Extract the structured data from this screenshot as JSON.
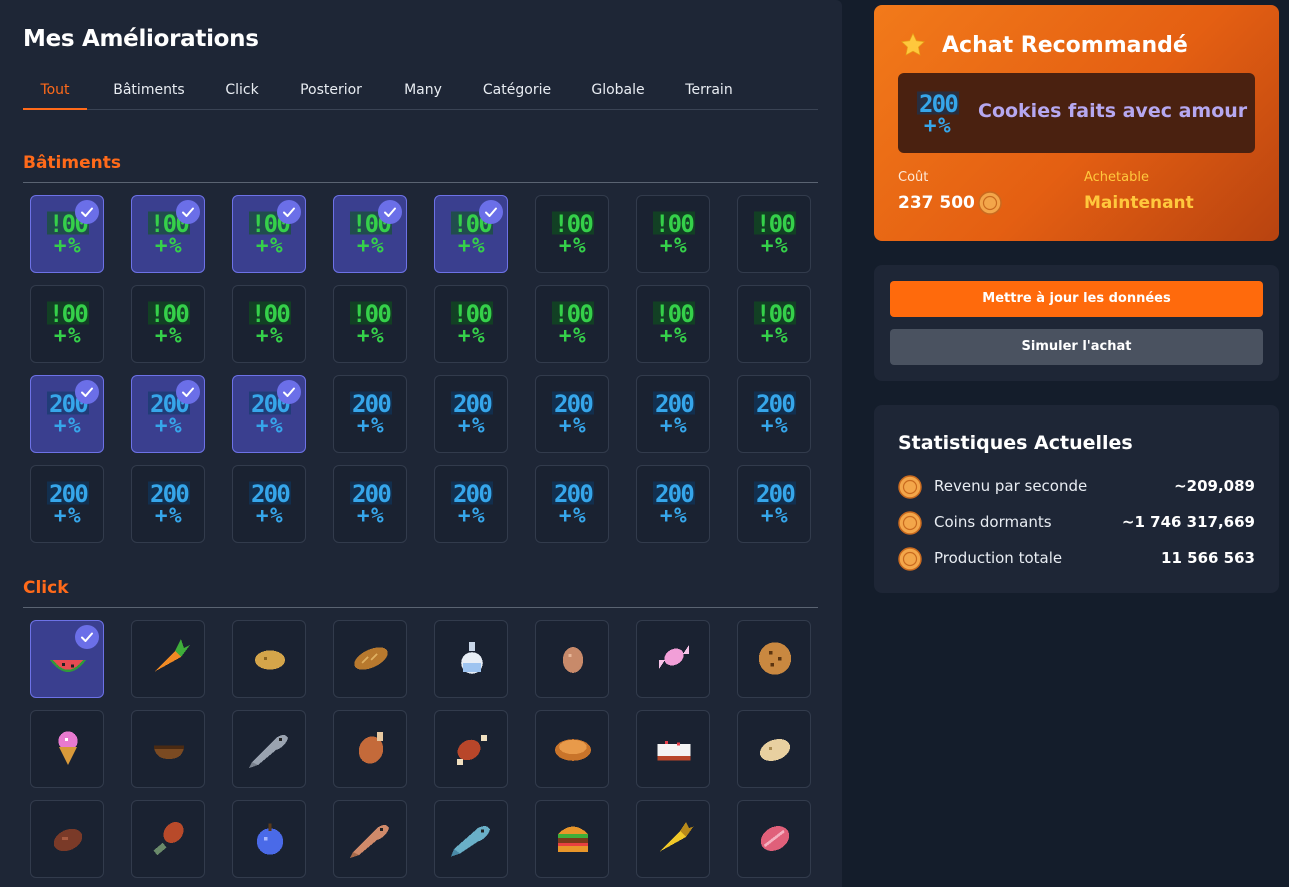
{
  "page_title": "Mes Améliorations",
  "tabs": [
    {
      "label": "Tout",
      "active": true
    },
    {
      "label": "Bâtiments",
      "active": false
    },
    {
      "label": "Click",
      "active": false
    },
    {
      "label": "Posterior",
      "active": false
    },
    {
      "label": "Many",
      "active": false
    },
    {
      "label": "Catégorie",
      "active": false
    },
    {
      "label": "Globale",
      "active": false
    },
    {
      "label": "Terrain",
      "active": false
    }
  ],
  "sections": {
    "batiments": {
      "title": "Bâtiments",
      "items": [
        {
          "icon": "100-percent-icon",
          "owned": true
        },
        {
          "icon": "100-percent-icon",
          "owned": true
        },
        {
          "icon": "100-percent-icon",
          "owned": true
        },
        {
          "icon": "100-percent-icon",
          "owned": true
        },
        {
          "icon": "100-percent-icon",
          "owned": true
        },
        {
          "icon": "100-percent-icon",
          "owned": false
        },
        {
          "icon": "100-percent-icon",
          "owned": false
        },
        {
          "icon": "100-percent-icon",
          "owned": false
        },
        {
          "icon": "100-percent-icon",
          "owned": false
        },
        {
          "icon": "100-percent-icon",
          "owned": false
        },
        {
          "icon": "100-percent-icon",
          "owned": false
        },
        {
          "icon": "100-percent-icon",
          "owned": false
        },
        {
          "icon": "100-percent-icon",
          "owned": false
        },
        {
          "icon": "100-percent-icon",
          "owned": false
        },
        {
          "icon": "100-percent-icon",
          "owned": false
        },
        {
          "icon": "100-percent-icon",
          "owned": false
        },
        {
          "icon": "200-percent-icon",
          "owned": true
        },
        {
          "icon": "200-percent-icon",
          "owned": true
        },
        {
          "icon": "200-percent-icon",
          "owned": true
        },
        {
          "icon": "200-percent-icon",
          "owned": false
        },
        {
          "icon": "200-percent-icon",
          "owned": false
        },
        {
          "icon": "200-percent-icon",
          "owned": false
        },
        {
          "icon": "200-percent-icon",
          "owned": false
        },
        {
          "icon": "200-percent-icon",
          "owned": false
        },
        {
          "icon": "200-percent-icon",
          "owned": false
        },
        {
          "icon": "200-percent-icon",
          "owned": false
        },
        {
          "icon": "200-percent-icon",
          "owned": false
        },
        {
          "icon": "200-percent-icon",
          "owned": false
        },
        {
          "icon": "200-percent-icon",
          "owned": false
        },
        {
          "icon": "200-percent-icon",
          "owned": false
        },
        {
          "icon": "200-percent-icon",
          "owned": false
        },
        {
          "icon": "200-percent-icon",
          "owned": false
        }
      ]
    },
    "click": {
      "title": "Click",
      "items": [
        {
          "icon": "watermelon-icon",
          "owned": true
        },
        {
          "icon": "carrot-icon",
          "owned": false
        },
        {
          "icon": "potato-icon",
          "owned": false
        },
        {
          "icon": "bread-icon",
          "owned": false
        },
        {
          "icon": "potion-bottle-icon",
          "owned": false
        },
        {
          "icon": "egg-icon",
          "owned": false
        },
        {
          "icon": "candy-icon",
          "owned": false
        },
        {
          "icon": "cookie-icon",
          "owned": false
        },
        {
          "icon": "ice-cream-icon",
          "owned": false
        },
        {
          "icon": "bowl-icon",
          "owned": false
        },
        {
          "icon": "raw-fish-icon",
          "owned": false
        },
        {
          "icon": "roast-chicken-icon",
          "owned": false
        },
        {
          "icon": "cooked-meat-icon",
          "owned": false
        },
        {
          "icon": "pumpkin-pie-icon",
          "owned": false
        },
        {
          "icon": "cake-icon",
          "owned": false
        },
        {
          "icon": "baked-potato-icon",
          "owned": false
        },
        {
          "icon": "steak-icon",
          "owned": false
        },
        {
          "icon": "drumstick-icon",
          "owned": false
        },
        {
          "icon": "blue-apple-icon",
          "owned": false
        },
        {
          "icon": "cooked-salmon-icon",
          "owned": false
        },
        {
          "icon": "blue-fish-icon",
          "owned": false
        },
        {
          "icon": "burger-icon",
          "owned": false
        },
        {
          "icon": "golden-carrot-icon",
          "owned": false
        },
        {
          "icon": "raw-meat-icon",
          "owned": false
        }
      ]
    }
  },
  "recommended": {
    "title": "Achat Recommandé",
    "item_name": "Cookies faits avec amour",
    "item_icon": "200-percent-icon",
    "cost_label": "Coût",
    "cost_value": "237 500",
    "buyable_label": "Achetable",
    "buyable_value": "Maintenant"
  },
  "actions": {
    "update_label": "Mettre à jour les données",
    "simulate_label": "Simuler l'achat"
  },
  "stats": {
    "title": "Statistiques Actuelles",
    "rows": [
      {
        "label": "Revenu par seconde",
        "value": "~209,089"
      },
      {
        "label": "Coins dormants",
        "value": "~1 746 317,669"
      },
      {
        "label": "Production totale",
        "value": "11 566 563"
      }
    ]
  },
  "colors": {
    "accent": "#ff6a1a",
    "owned_bg": "#3a3f8f",
    "check": "#6b6fe8",
    "green_icon": "#2ecc40",
    "blue_icon": "#2a9fe0"
  }
}
